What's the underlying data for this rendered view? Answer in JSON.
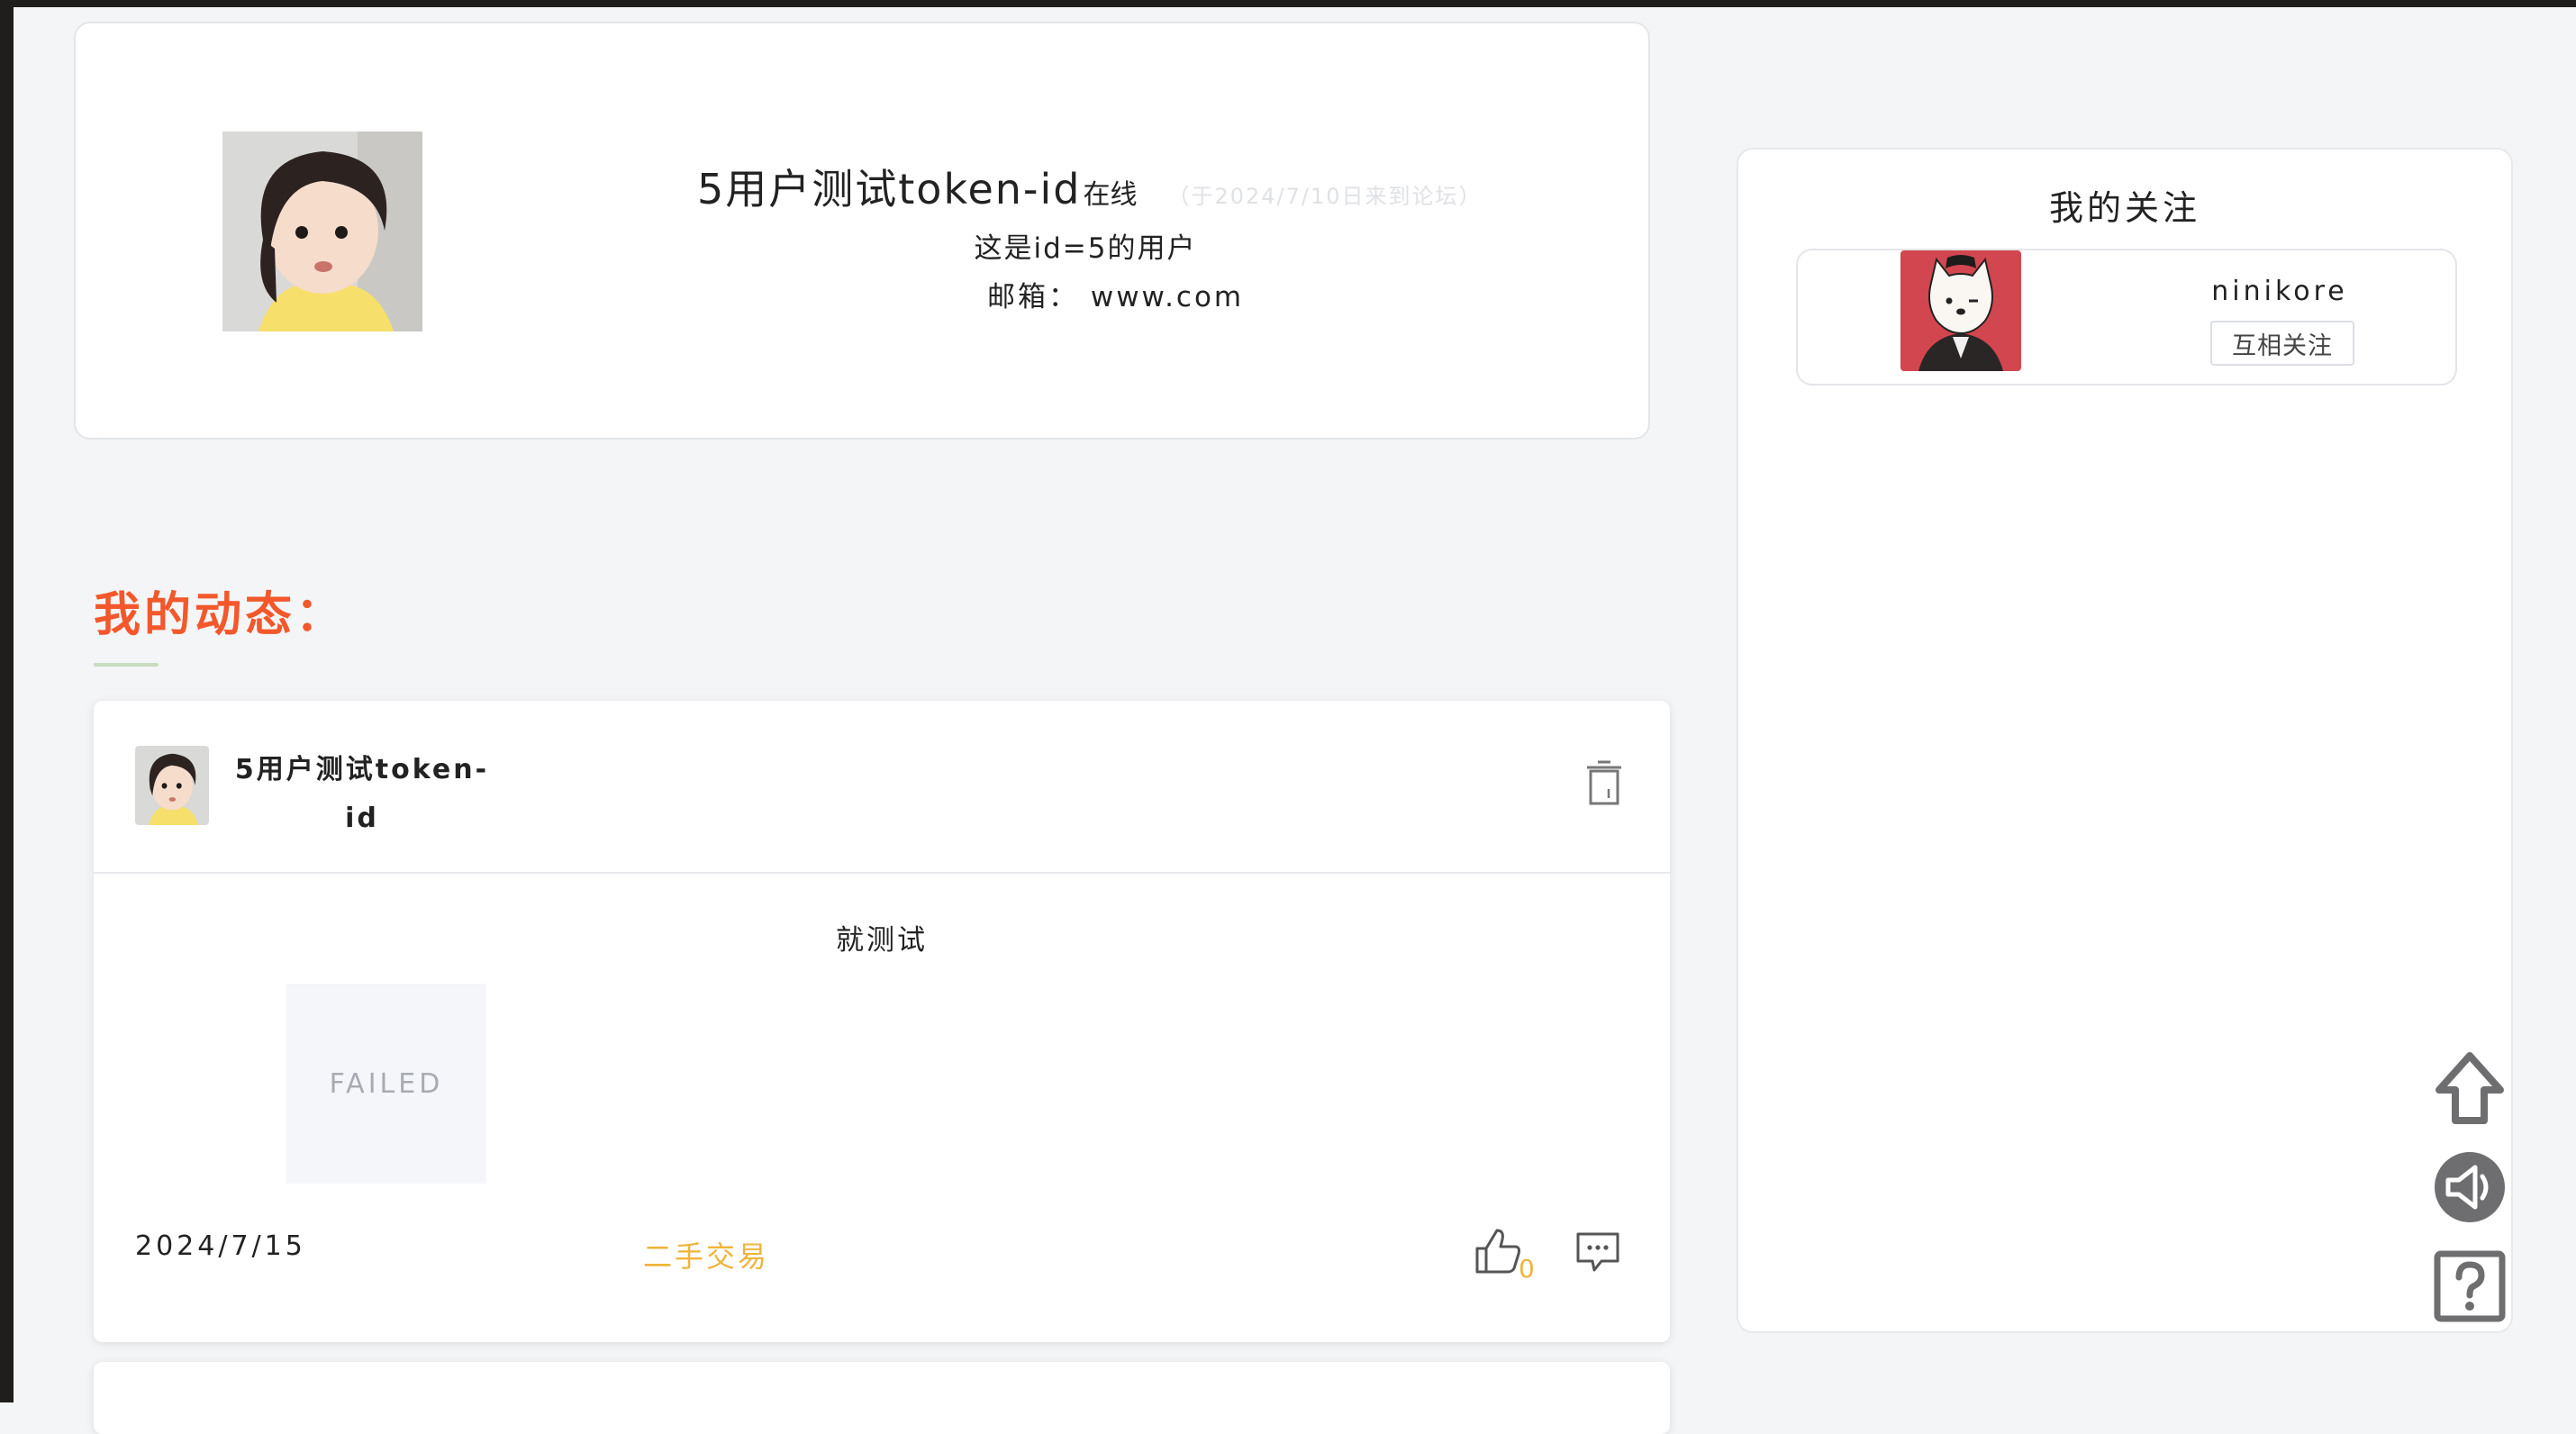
{
  "profile": {
    "name": "5用户测试token-id",
    "online_label": "在线",
    "joined_note": "（于2024/7/10日来到论坛）",
    "description": "这是id=5的用户",
    "email_line": "邮箱：  www.com"
  },
  "section": {
    "title": "我的动态："
  },
  "post": {
    "author": "5用户测试token-id",
    "text": "就测试",
    "image_status": "FAILED",
    "date": "2024/7/15",
    "tag": "二手交易",
    "like_count": "0"
  },
  "following": {
    "title": "我的关注",
    "items": [
      {
        "name": "ninikore",
        "status_label": "互相关注"
      }
    ]
  },
  "tools": {
    "icons": [
      "arrow-up-icon",
      "speaker-icon",
      "question-icon"
    ]
  },
  "colors": {
    "accent_orange": "#f2582b",
    "tag_yellow": "#f0b43a",
    "background": "#f4f5f7"
  }
}
